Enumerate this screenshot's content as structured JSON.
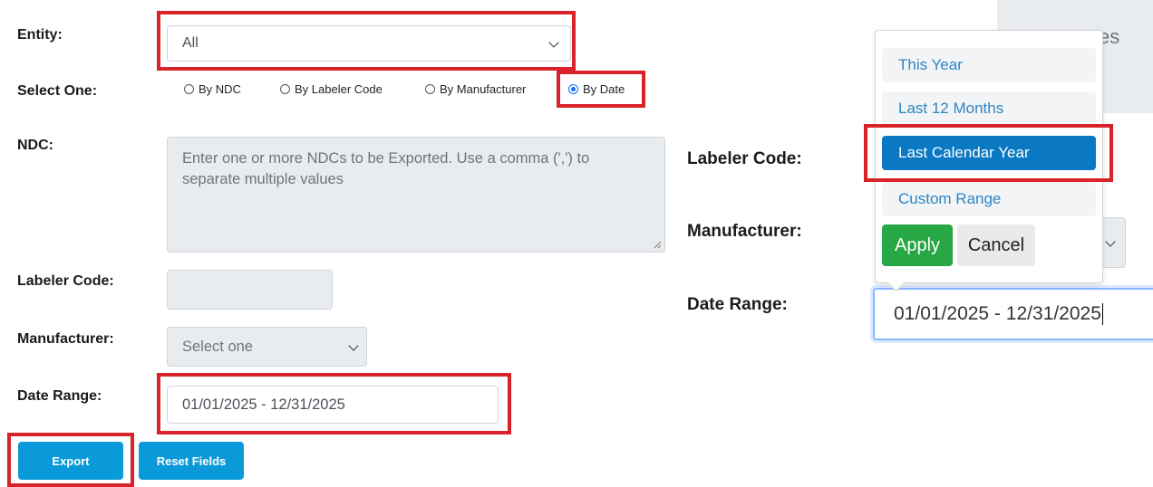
{
  "left_form": {
    "entity": {
      "label": "Entity:",
      "value": "All"
    },
    "select_one": {
      "label": "Select One:",
      "options": [
        {
          "label": "By NDC",
          "selected": false
        },
        {
          "label": "By Labeler Code",
          "selected": false
        },
        {
          "label": "By Manufacturer",
          "selected": false
        },
        {
          "label": "By Date",
          "selected": true
        }
      ]
    },
    "ndc": {
      "label": "NDC:",
      "placeholder": "Enter one or more NDCs to be Exported. Use a comma (',') to separate multiple values"
    },
    "labeler_code": {
      "label": "Labeler Code:",
      "value": ""
    },
    "manufacturer": {
      "label": "Manufacturer:",
      "value": "Select one"
    },
    "date_range": {
      "label": "Date Range:",
      "value": "01/01/2025 - 12/31/2025"
    },
    "buttons": {
      "export": "Export",
      "reset": "Reset Fields"
    }
  },
  "right_panel": {
    "partial_text": "es",
    "labeler_code_label": "Labeler Code:",
    "manufacturer_label": "Manufacturer:",
    "date_range_label": "Date Range:",
    "date_range_value": "01/01/2025 - 12/31/2025",
    "ranges_menu": {
      "items": [
        {
          "label": "This Year",
          "active": false
        },
        {
          "label": "Last 12 Months",
          "active": false
        },
        {
          "label": "Last Calendar Year",
          "active": true
        },
        {
          "label": "Custom Range",
          "active": false
        }
      ],
      "apply": "Apply",
      "cancel": "Cancel"
    }
  },
  "colors": {
    "highlight": "#d9232a",
    "primary": "#0a9ad9",
    "apply": "#28a745",
    "active_item": "#0a78c2"
  }
}
